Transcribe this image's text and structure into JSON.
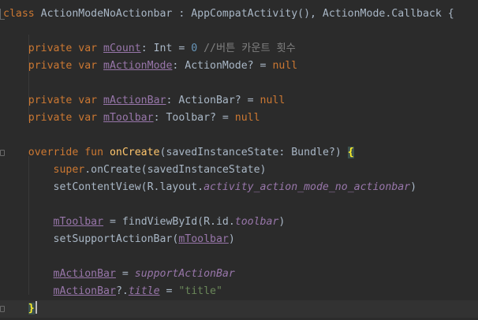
{
  "editor": {
    "lines": [
      {
        "segments": [
          {
            "t": "class",
            "c": "kw"
          },
          {
            "t": " ActionModeNoActionbar : AppCompatActivity(), ActionMode.Callback {",
            "c": "plain"
          }
        ]
      },
      {
        "segments": []
      },
      {
        "segments": [
          {
            "t": "    private var ",
            "c": "kw"
          },
          {
            "t": "mCount",
            "c": "prop"
          },
          {
            "t": ": Int = ",
            "c": "plain"
          },
          {
            "t": "0",
            "c": "num"
          },
          {
            "t": " //버튼 카운트 횟수",
            "c": "cm"
          }
        ]
      },
      {
        "segments": [
          {
            "t": "    private var ",
            "c": "kw"
          },
          {
            "t": "mActionMode",
            "c": "prop"
          },
          {
            "t": ": ActionMode? = ",
            "c": "plain"
          },
          {
            "t": "null",
            "c": "kw"
          }
        ]
      },
      {
        "segments": []
      },
      {
        "segments": [
          {
            "t": "    private var ",
            "c": "kw"
          },
          {
            "t": "mActionBar",
            "c": "prop"
          },
          {
            "t": ": ActionBar? = ",
            "c": "plain"
          },
          {
            "t": "null",
            "c": "kw"
          }
        ]
      },
      {
        "segments": [
          {
            "t": "    private var ",
            "c": "kw"
          },
          {
            "t": "mToolbar",
            "c": "prop"
          },
          {
            "t": ": Toolbar? = ",
            "c": "plain"
          },
          {
            "t": "null",
            "c": "kw"
          }
        ]
      },
      {
        "segments": []
      },
      {
        "segments": [
          {
            "t": "    override fun ",
            "c": "kw"
          },
          {
            "t": "onCreate",
            "c": "fn"
          },
          {
            "t": "(savedInstanceState: Bundle?) ",
            "c": "plain"
          },
          {
            "t": "{",
            "c": "brace"
          }
        ]
      },
      {
        "segments": [
          {
            "t": "        super",
            "c": "kw"
          },
          {
            "t": ".onCreate(savedInstanceState)",
            "c": "plain"
          }
        ]
      },
      {
        "segments": [
          {
            "t": "        setContentView(R.layout.",
            "c": "plain"
          },
          {
            "t": "activity_action_mode_no_actionbar",
            "c": "ital"
          },
          {
            "t": ")",
            "c": "plain"
          }
        ]
      },
      {
        "segments": []
      },
      {
        "segments": [
          {
            "t": "        ",
            "c": "plain"
          },
          {
            "t": "mToolbar",
            "c": "prop"
          },
          {
            "t": " = findViewById(R.id.",
            "c": "plain"
          },
          {
            "t": "toolbar",
            "c": "ital"
          },
          {
            "t": ")",
            "c": "plain"
          }
        ]
      },
      {
        "segments": [
          {
            "t": "        setSupportActionBar(",
            "c": "plain"
          },
          {
            "t": "mToolbar",
            "c": "prop"
          },
          {
            "t": ")",
            "c": "plain"
          }
        ]
      },
      {
        "segments": []
      },
      {
        "segments": [
          {
            "t": "        ",
            "c": "plain"
          },
          {
            "t": "mActionBar",
            "c": "prop"
          },
          {
            "t": " = ",
            "c": "plain"
          },
          {
            "t": "supportActionBar",
            "c": "ital"
          }
        ]
      },
      {
        "segments": [
          {
            "t": "        ",
            "c": "plain"
          },
          {
            "t": "mActionBar",
            "c": "prop"
          },
          {
            "t": "?.",
            "c": "plain"
          },
          {
            "t": "title",
            "c": "ital-u"
          },
          {
            "t": " = ",
            "c": "plain"
          },
          {
            "t": "\"title\"",
            "c": "str"
          }
        ]
      },
      {
        "segments": [
          {
            "t": "    ",
            "c": "plain"
          },
          {
            "t": "}",
            "c": "brace"
          }
        ]
      }
    ],
    "current_line": 17,
    "fold_marker_lines": [
      0,
      8,
      17
    ],
    "colors": {
      "background": "#2b2b2b",
      "keyword": "#cc7832",
      "property": "#9876aa",
      "function": "#ffc66d",
      "number": "#6897bb",
      "comment": "#808080",
      "string": "#6a8759",
      "text": "#a9b7c6"
    }
  }
}
